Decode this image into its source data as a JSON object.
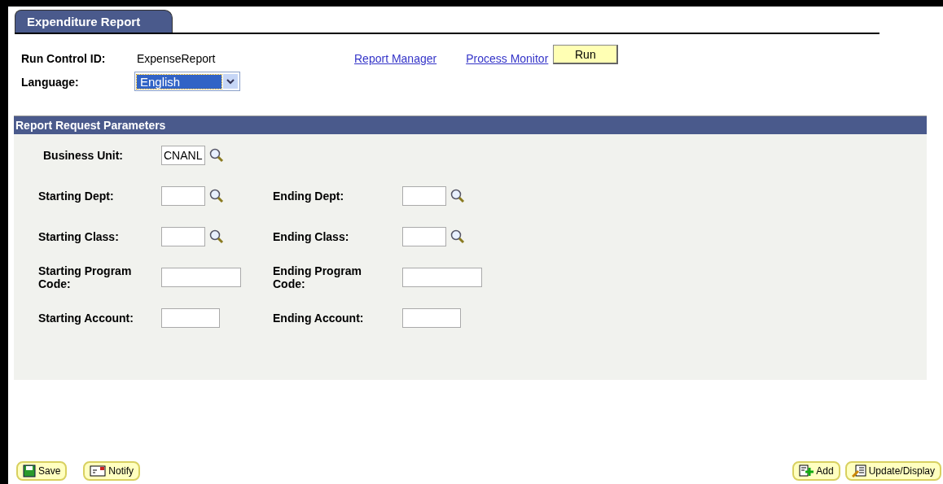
{
  "tab": {
    "label": "Expenditure Report",
    "selected": true
  },
  "run_control": {
    "label": "Run Control ID:",
    "value": "ExpenseReport"
  },
  "language": {
    "label": "Language:",
    "value": "English"
  },
  "links": [
    "Report Manager",
    "Process Monitor"
  ],
  "run_button": "Run",
  "section": {
    "title": "Report Request Parameters",
    "rows": [
      [
        {
          "label": "Business Unit:",
          "value": "CNANL",
          "kind": "lookup"
        }
      ],
      [
        {
          "label": "Starting Dept:",
          "kind": "lookup"
        },
        {
          "label": "Ending Dept:",
          "kind": "lookup"
        }
      ],
      [
        {
          "label": "Starting Class:",
          "kind": "lookup"
        },
        {
          "label": "Ending Class:",
          "kind": "lookup"
        }
      ],
      [
        {
          "label": "Starting Program Code:",
          "kind": "long"
        },
        {
          "label": "Ending Program Code:",
          "kind": "long"
        }
      ],
      [
        {
          "label": "Starting Account:",
          "kind": "short"
        },
        {
          "label": "Ending Account:",
          "kind": "short"
        }
      ]
    ]
  },
  "footer": {
    "left": [
      {
        "label": "Save",
        "kind": "save"
      },
      {
        "label": "Notify",
        "kind": "notify"
      }
    ],
    "right": [
      {
        "label": "Add",
        "kind": "add"
      },
      {
        "label": "Update/Display",
        "kind": "update"
      }
    ]
  }
}
